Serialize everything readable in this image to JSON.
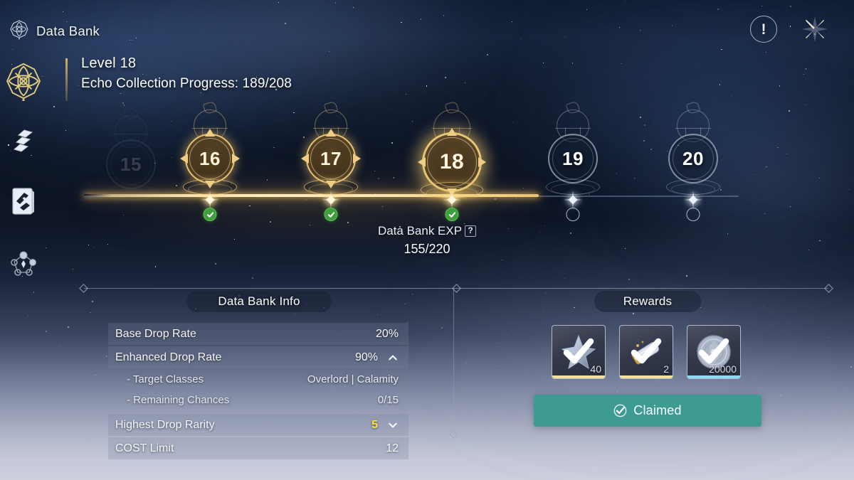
{
  "header": {
    "title": "Data Bank",
    "emblem_icon": "data-bank-emblem-icon",
    "warning_icon": "!",
    "close_icon": "close-star-icon"
  },
  "sidebar": {
    "items": [
      {
        "icon": "data-bank-emblem-icon",
        "active": true
      },
      {
        "icon": "echo-stack-icon",
        "active": false
      },
      {
        "icon": "echo-catalog-book-icon",
        "active": false
      },
      {
        "icon": "echo-network-nodes-icon",
        "active": false
      }
    ]
  },
  "level_header": {
    "level": "Level 18",
    "echo_progress": "Echo Collection Progress: 189/208"
  },
  "track": {
    "faded_node_label": "15",
    "nodes": [
      {
        "label": "16",
        "state": "done",
        "badge": "check"
      },
      {
        "label": "17",
        "state": "done",
        "badge": "check"
      },
      {
        "label": "18",
        "state": "current",
        "badge": "check"
      },
      {
        "label": "19",
        "state": "todo",
        "badge": "circle"
      },
      {
        "label": "20",
        "state": "todo",
        "badge": "circle"
      }
    ]
  },
  "exp": {
    "label": "Data Bank EXP",
    "help_icon": "?",
    "value": "155/220"
  },
  "info_panel": {
    "title": "Data Bank Info",
    "rows": [
      {
        "key": "Base Drop Rate",
        "value": "20%",
        "sub": false,
        "chevron": "",
        "value_color": "normal"
      },
      {
        "key": "Enhanced Drop Rate",
        "value": "90%",
        "sub": false,
        "chevron": "up",
        "value_color": "normal"
      },
      {
        "key": "- Target Classes",
        "value": "Overlord | Calamity",
        "sub": true,
        "chevron": "",
        "value_color": "normal"
      },
      {
        "key": "- Remaining Chances",
        "value": "0/15",
        "sub": true,
        "chevron": "",
        "value_color": "normal"
      },
      {
        "key": "Highest Drop Rarity",
        "value": "5",
        "sub": false,
        "chevron": "down",
        "value_color": "yellow"
      },
      {
        "key": "COST Limit",
        "value": "12",
        "sub": false,
        "chevron": "",
        "value_color": "normal"
      }
    ]
  },
  "rewards_panel": {
    "title": "Rewards",
    "items": [
      {
        "icon": "shell-credit-star-icon",
        "qty": "40",
        "rarity_color": "#f0df9e",
        "claimed": true
      },
      {
        "icon": "exp-tube-icon",
        "qty": "2",
        "rarity_color": "#f0df9e",
        "claimed": true
      },
      {
        "icon": "shell-coin-icon",
        "qty": "20000",
        "rarity_color": "#8fd7f2",
        "claimed": true
      }
    ],
    "claim_button": {
      "label": "Claimed",
      "icon": "check-circle-icon",
      "color": "#3e9b94"
    }
  },
  "colors": {
    "gold": "#e8c473",
    "gold_bright": "#ffe9b4",
    "teal": "#3e9b94",
    "green_check": "#3ea03c",
    "yellow": "#ffe23c",
    "bg_top": "#101c33",
    "bg_bottom": "#ccd0dd"
  }
}
